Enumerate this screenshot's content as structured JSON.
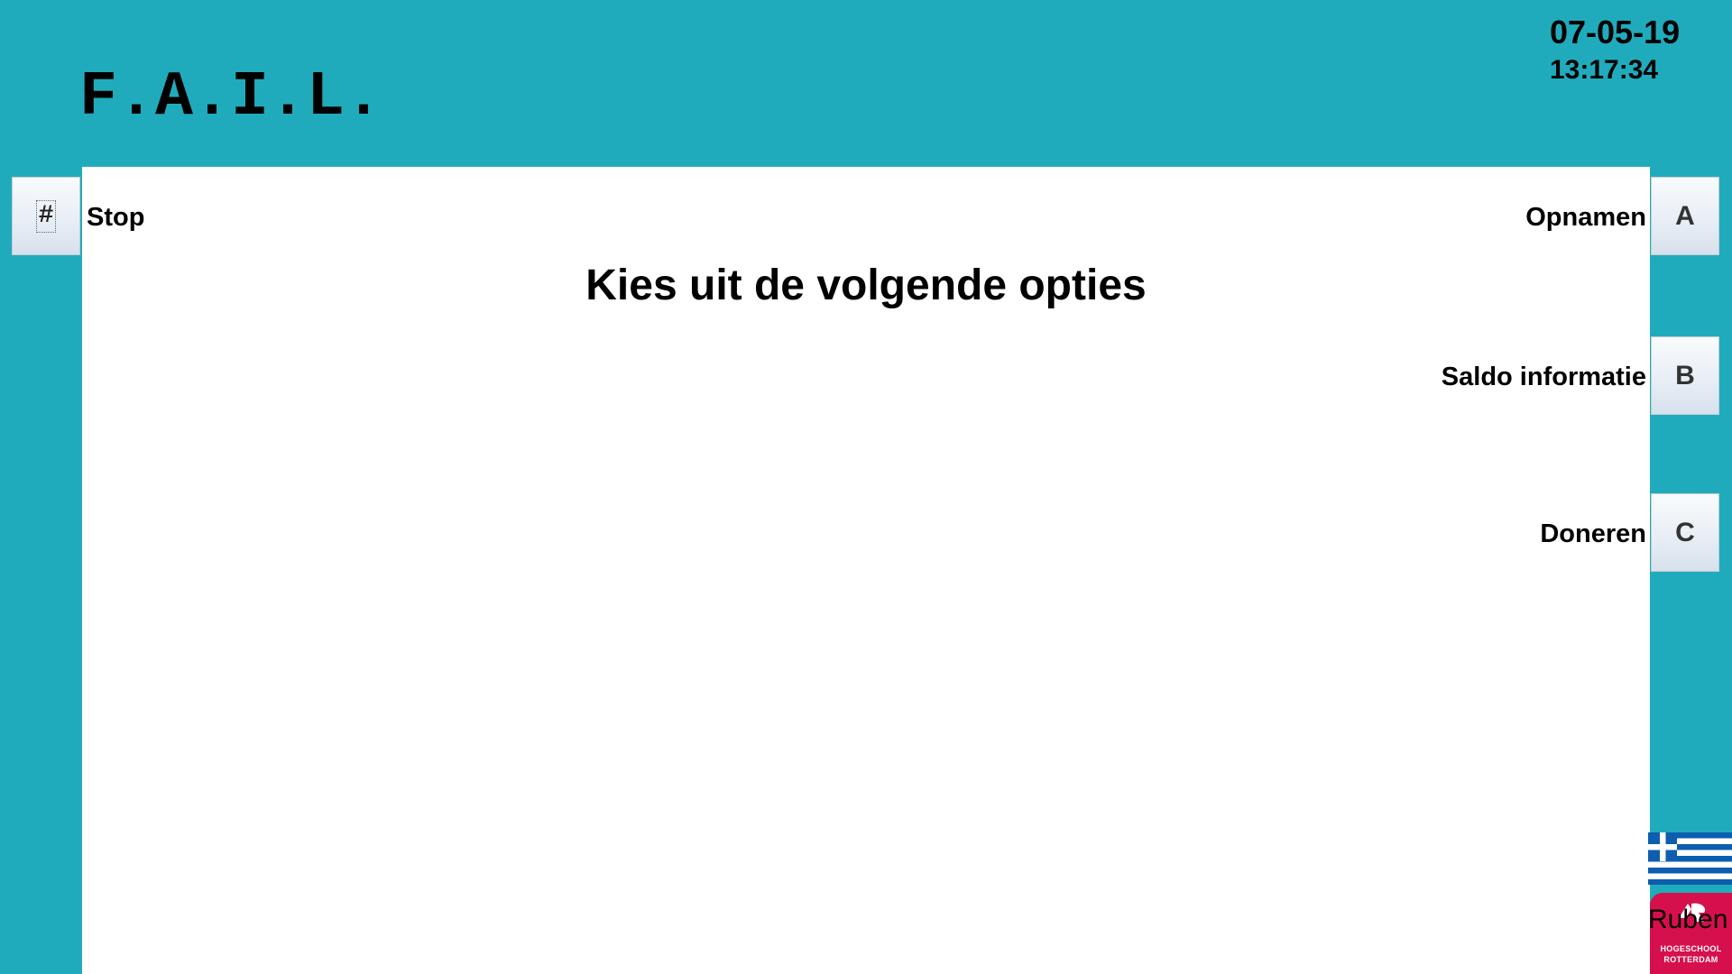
{
  "app": {
    "logo_text": "F.A.I.L."
  },
  "clock": {
    "date": "07-05-19",
    "time": "13:17:34"
  },
  "main": {
    "heading": "Kies uit de volgende opties"
  },
  "keys": {
    "hash": "#",
    "a": "A",
    "b": "B",
    "c": "C"
  },
  "options": {
    "stop": "Stop",
    "a": "Opnamen",
    "b": "Saldo informatie",
    "c": "Doneren"
  },
  "footer": {
    "user_name": "Ruben",
    "school_line1": "HOGESCHOOL",
    "school_line2": "ROTTERDAM",
    "language_flag": "greek-flag-icon"
  },
  "colors": {
    "background": "#20abbc",
    "panel": "#ffffff",
    "school_brand": "#d6104d",
    "flag_blue": "#0d5eaf"
  }
}
